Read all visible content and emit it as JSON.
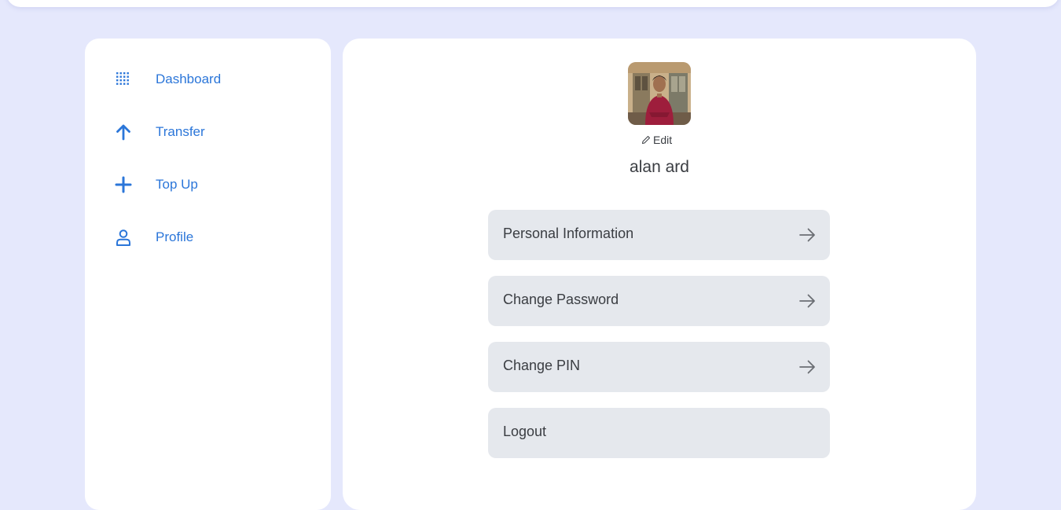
{
  "sidebar": {
    "items": [
      {
        "label": "Dashboard",
        "icon": "grid-icon"
      },
      {
        "label": "Transfer",
        "icon": "arrow-up-icon"
      },
      {
        "label": "Top Up",
        "icon": "plus-icon"
      },
      {
        "label": "Profile",
        "icon": "user-icon"
      }
    ]
  },
  "profile": {
    "edit_label": "Edit",
    "name": "alan ard",
    "menu": [
      {
        "label": "Personal Information",
        "icon": "arrow-right-icon"
      },
      {
        "label": "Change Password",
        "icon": "arrow-right-icon"
      },
      {
        "label": "Change PIN",
        "icon": "arrow-right-icon"
      },
      {
        "label": "Logout"
      }
    ]
  },
  "colors": {
    "background": "#e5e8fc",
    "accent": "#2b76d9",
    "button_bg": "#e5e8ed",
    "text": "#3a3d42"
  }
}
